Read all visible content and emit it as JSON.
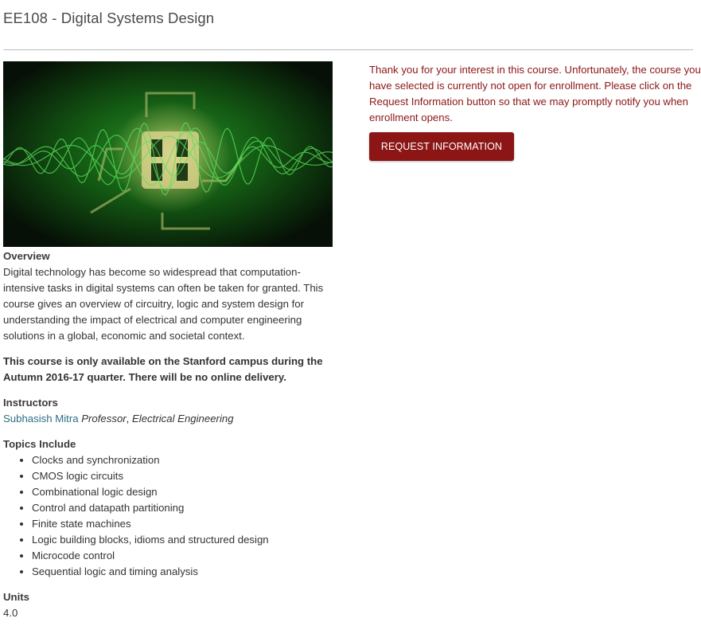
{
  "course": {
    "title": "EE108 - Digital Systems Design"
  },
  "hero_image": {
    "name": "digital-circuit-waveform-image"
  },
  "overview": {
    "heading": "Overview",
    "text": "Digital technology has become so widespread that computation-intensive tasks in digital systems can often be taken for granted. This course gives an overview of circuitry, logic and system design for understanding the impact of electrical and computer engineering solutions in a global, economic and societal context.",
    "notice": "This course is only available on the Stanford campus during the Autumn 2016-17 quarter. There will be no online delivery."
  },
  "instructors": {
    "heading": "Instructors",
    "items": [
      {
        "name": "Subhasish Mitra",
        "title": "Professor",
        "department": "Electrical Engineering"
      }
    ]
  },
  "topics": {
    "heading": "Topics Include",
    "items": [
      "Clocks and synchronization",
      "CMOS logic circuits",
      "Combinational logic design",
      "Control and datapath partitioning",
      "Finite state machines",
      "Logic building blocks, idioms and structured design",
      "Microcode control",
      "Sequential logic and timing analysis"
    ]
  },
  "units": {
    "heading": "Units",
    "value": "4.0"
  },
  "enrollment": {
    "message": "Thank you for your interest in this course. Unfortunately, the course you have selected is currently not open for enrollment. Please click on the Request Information button so that we may promptly notify you when enrollment opens.",
    "button_label": "REQUEST INFORMATION"
  },
  "colors": {
    "accent": "#8c1515",
    "link": "#2b6f86"
  }
}
